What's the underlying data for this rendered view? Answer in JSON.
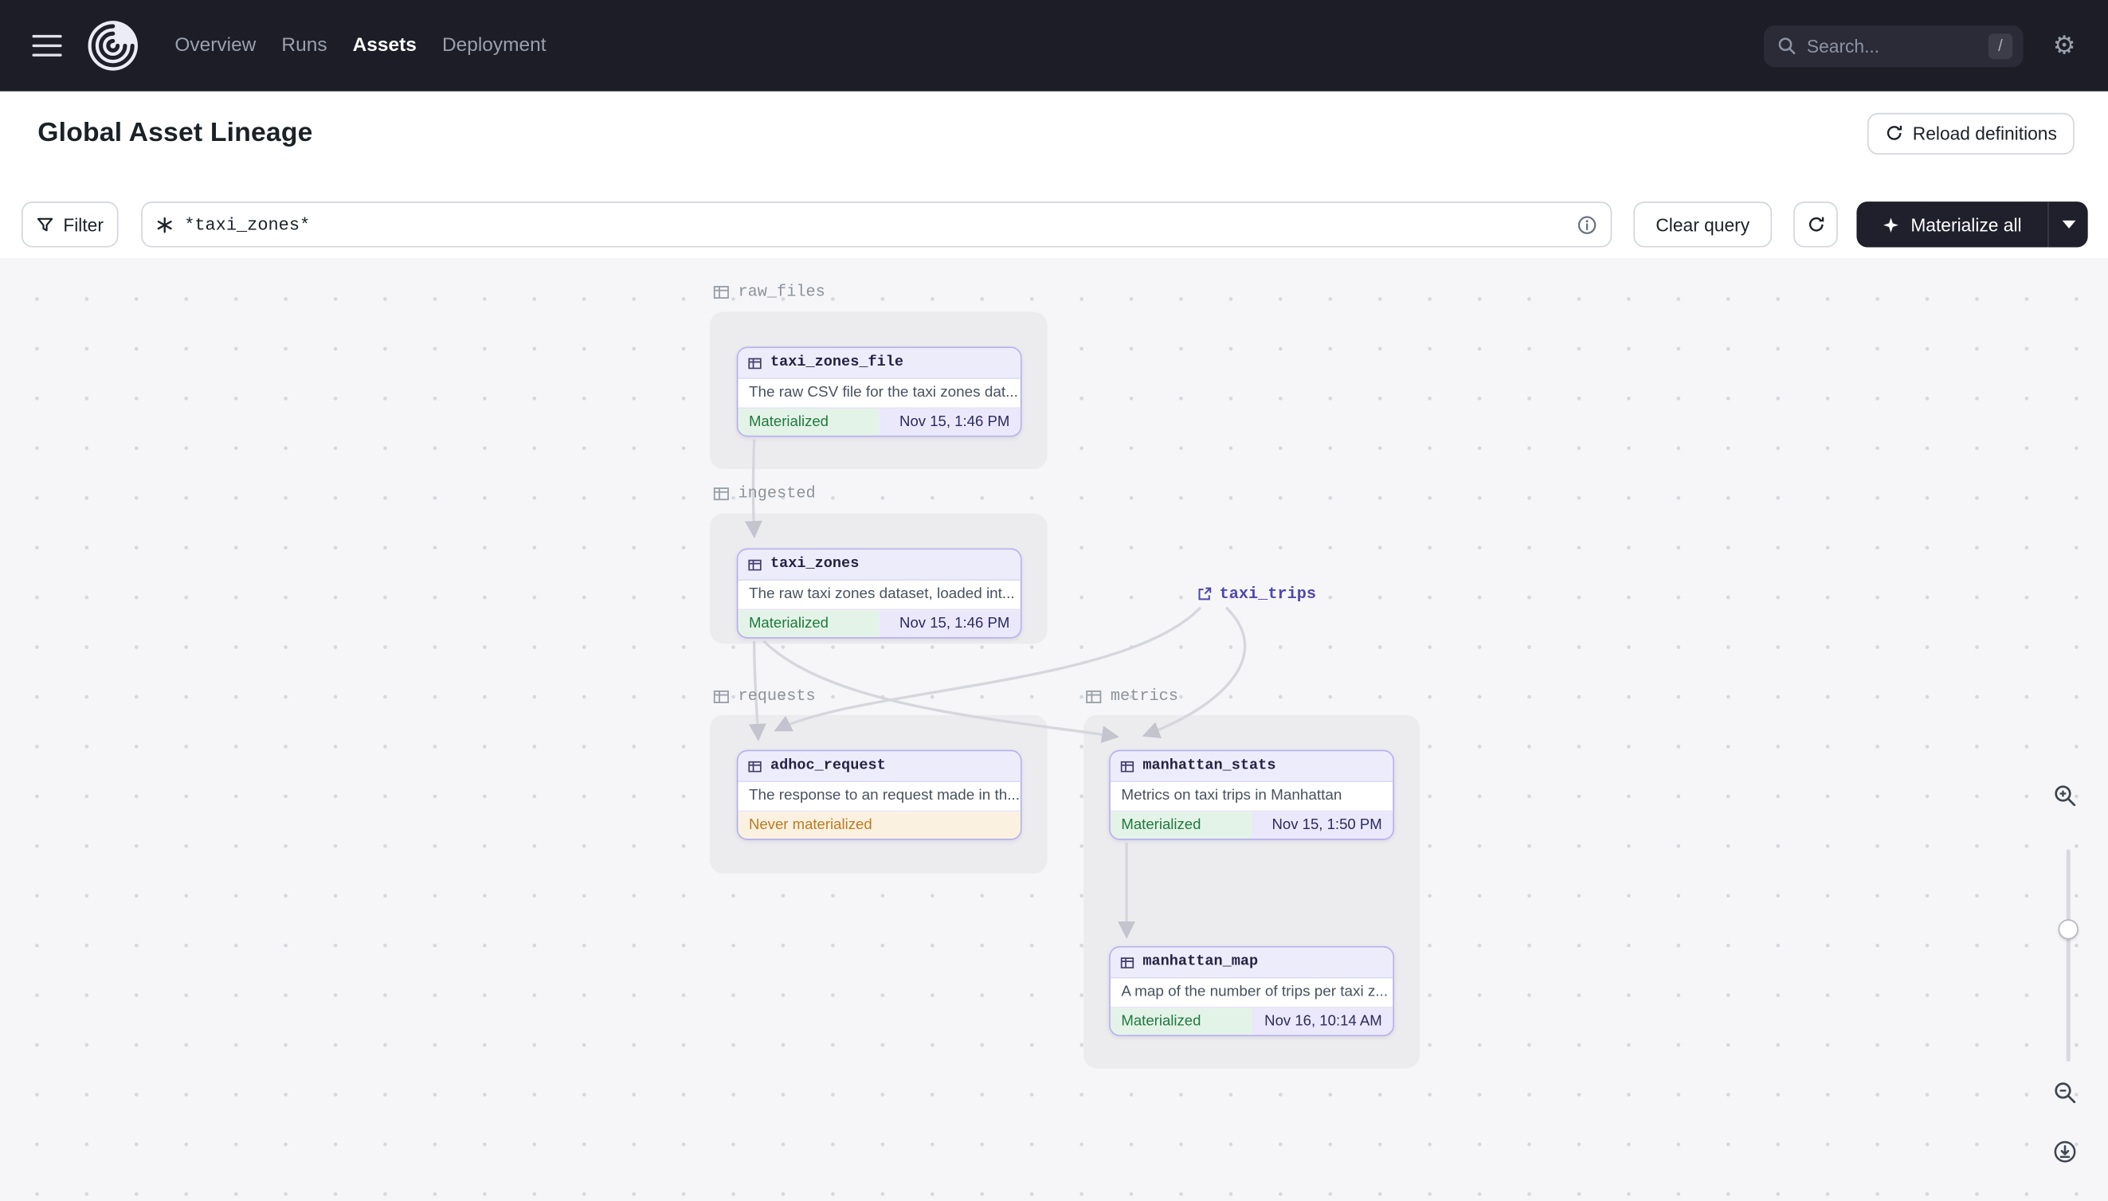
{
  "topnav": {
    "nav": [
      {
        "label": "Overview",
        "active": false
      },
      {
        "label": "Runs",
        "active": false
      },
      {
        "label": "Assets",
        "active": true
      },
      {
        "label": "Deployment",
        "active": false
      }
    ],
    "search": {
      "placeholder": "Search...",
      "shortcut": "/"
    }
  },
  "header": {
    "title": "Global Asset Lineage",
    "reload_button_label": "Reload definitions"
  },
  "toolbar": {
    "filter_label": "Filter",
    "query_value": "*taxi_zones*",
    "clear_query_label": "Clear query",
    "materialize_label": "Materialize all"
  },
  "graph": {
    "groups": [
      {
        "name": "raw_files"
      },
      {
        "name": "ingested"
      },
      {
        "name": "requests"
      },
      {
        "name": "metrics"
      }
    ],
    "nodes": [
      {
        "id": "taxi_zones_file",
        "group": "raw_files",
        "title": "taxi_zones_file",
        "description": "The raw CSV file for the taxi zones dat...",
        "status": "Materialized",
        "timestamp": "Nov 15, 1:46 PM"
      },
      {
        "id": "taxi_zones",
        "group": "ingested",
        "title": "taxi_zones",
        "description": "The raw taxi zones dataset, loaded int...",
        "status": "Materialized",
        "timestamp": "Nov 15, 1:46 PM"
      },
      {
        "id": "adhoc_request",
        "group": "requests",
        "title": "adhoc_request",
        "description": "The response to an request made in th...",
        "status": "Never materialized",
        "timestamp": ""
      },
      {
        "id": "manhattan_stats",
        "group": "metrics",
        "title": "manhattan_stats",
        "description": "Metrics on taxi trips in Manhattan",
        "status": "Materialized",
        "timestamp": "Nov 15, 1:50 PM"
      },
      {
        "id": "manhattan_map",
        "group": "metrics",
        "title": "manhattan_map",
        "description": "A map of the number of trips per taxi z...",
        "status": "Materialized",
        "timestamp": "Nov 16, 10:14 AM"
      }
    ],
    "external_nodes": [
      {
        "title": "taxi_trips"
      }
    ],
    "edges": [
      {
        "from": "taxi_zones_file",
        "to": "taxi_zones"
      },
      {
        "from": "taxi_zones",
        "to": "adhoc_request"
      },
      {
        "from": "taxi_zones",
        "to": "manhattan_stats"
      },
      {
        "from": "taxi_trips",
        "to": "adhoc_request"
      },
      {
        "from": "taxi_trips",
        "to": "manhattan_stats"
      },
      {
        "from": "manhattan_stats",
        "to": "manhattan_map"
      }
    ]
  },
  "icons": {
    "gear": "⚙"
  },
  "colors": {
    "topbar_bg": "#1d1d27",
    "canvas_bg": "#f6f6f8",
    "accent_purple": "#4f47ad",
    "card_border": "#b6b1ec",
    "card_header_bg": "#edecfb",
    "materialized_bg": "#e4f3e8",
    "materialized_text": "#1e7a3c",
    "never_materialized_bg": "#fbf1e1",
    "never_materialized_text": "#bd7a20",
    "timestamp_bg": "#eae8fa",
    "timestamp_text": "#2c2a60"
  }
}
